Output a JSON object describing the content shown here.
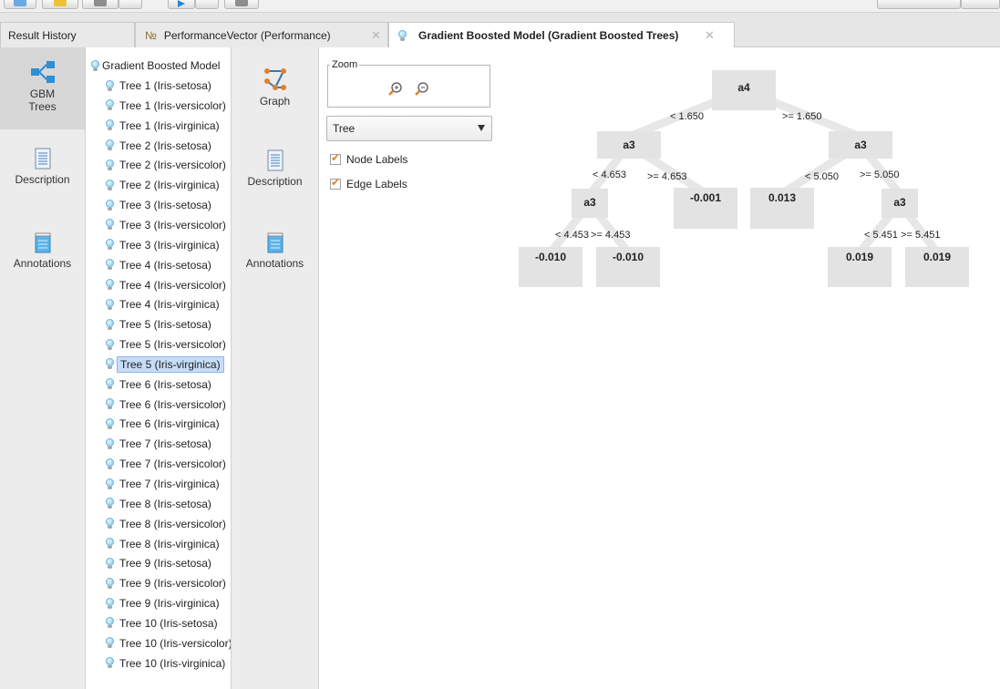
{
  "tabs": [
    {
      "label": "Result History",
      "icon": "none"
    },
    {
      "label": "PerformanceVector (Performance)",
      "icon": "performance-icon"
    },
    {
      "label": "Gradient Boosted Model (Gradient Boosted Trees)",
      "icon": "lightbulb-icon"
    }
  ],
  "left_panel": {
    "items": [
      {
        "label": "GBM Trees",
        "icon": "share-tree-icon"
      },
      {
        "label": "Description",
        "icon": "document-icon"
      },
      {
        "label": "Annotations",
        "icon": "notepad-icon"
      }
    ]
  },
  "tree_panel": {
    "root_label": "Gradient Boosted Model",
    "items": [
      "Tree 1 (Iris-setosa)",
      "Tree 1 (Iris-versicolor)",
      "Tree 1 (Iris-virginica)",
      "Tree 2 (Iris-setosa)",
      "Tree 2 (Iris-versicolor)",
      "Tree 2 (Iris-virginica)",
      "Tree 3 (Iris-setosa)",
      "Tree 3 (Iris-versicolor)",
      "Tree 3 (Iris-virginica)",
      "Tree 4 (Iris-setosa)",
      "Tree 4 (Iris-versicolor)",
      "Tree 4 (Iris-virginica)",
      "Tree 5 (Iris-setosa)",
      "Tree 5 (Iris-versicolor)",
      "Tree 5 (Iris-virginica)",
      "Tree 6 (Iris-setosa)",
      "Tree 6 (Iris-versicolor)",
      "Tree 6 (Iris-virginica)",
      "Tree 7 (Iris-setosa)",
      "Tree 7 (Iris-versicolor)",
      "Tree 7 (Iris-virginica)",
      "Tree 8 (Iris-setosa)",
      "Tree 8 (Iris-versicolor)",
      "Tree 8 (Iris-virginica)",
      "Tree 9 (Iris-setosa)",
      "Tree 9 (Iris-versicolor)",
      "Tree 9 (Iris-virginica)",
      "Tree 10 (Iris-setosa)",
      "Tree 10 (Iris-versicolor)",
      "Tree 10 (Iris-virginica)"
    ],
    "selected": "Tree 5 (Iris-virginica)"
  },
  "view_panel": {
    "items": [
      {
        "label": "Graph",
        "icon": "graph-icon"
      },
      {
        "label": "Description",
        "icon": "document-icon"
      },
      {
        "label": "Annotations",
        "icon": "notepad-icon"
      }
    ]
  },
  "options": {
    "zoom_label": "Zoom",
    "zoom_in_icon": "zoom-in-icon",
    "zoom_out_icon": "zoom-out-icon",
    "layout_select": "Tree",
    "node_labels": {
      "label": "Node Labels",
      "checked": true
    },
    "edge_labels": {
      "label": "Edge Labels",
      "checked": true
    }
  },
  "tree_graph": {
    "nodes": [
      {
        "id": "root",
        "label": "a4"
      },
      {
        "id": "l",
        "label": "a3"
      },
      {
        "id": "r",
        "label": "a3"
      },
      {
        "id": "ll",
        "label": "a3"
      },
      {
        "id": "lr",
        "label": "-0.001"
      },
      {
        "id": "rl",
        "label": "0.013"
      },
      {
        "id": "rr",
        "label": "a3"
      },
      {
        "id": "lll",
        "label": "-0.010"
      },
      {
        "id": "llr",
        "label": "-0.010"
      },
      {
        "id": "rrl",
        "label": "0.019"
      },
      {
        "id": "rrr",
        "label": "0.019"
      }
    ],
    "edges": [
      {
        "from": "root",
        "to": "l",
        "label": "< 1.650"
      },
      {
        "from": "root",
        "to": "r",
        "label": ">= 1.650"
      },
      {
        "from": "l",
        "to": "ll",
        "label": "< 4.653"
      },
      {
        "from": "l",
        "to": "lr",
        "label": ">= 4.653"
      },
      {
        "from": "r",
        "to": "rl",
        "label": "< 5.050"
      },
      {
        "from": "r",
        "to": "rr",
        "label": ">= 5.050"
      },
      {
        "from": "ll",
        "to": "lll",
        "label": "< 4.453"
      },
      {
        "from": "ll",
        "to": "llr",
        "label": ">= 4.453"
      },
      {
        "from": "rr",
        "to": "rrl",
        "label": "< 5.451"
      },
      {
        "from": "rr",
        "to": "rrr",
        "label": ">= 5.451"
      }
    ]
  },
  "colors": {
    "accent_orange": "#e0822a",
    "selection": "#c7ddf7",
    "node_fill": "#e3e3e3"
  }
}
